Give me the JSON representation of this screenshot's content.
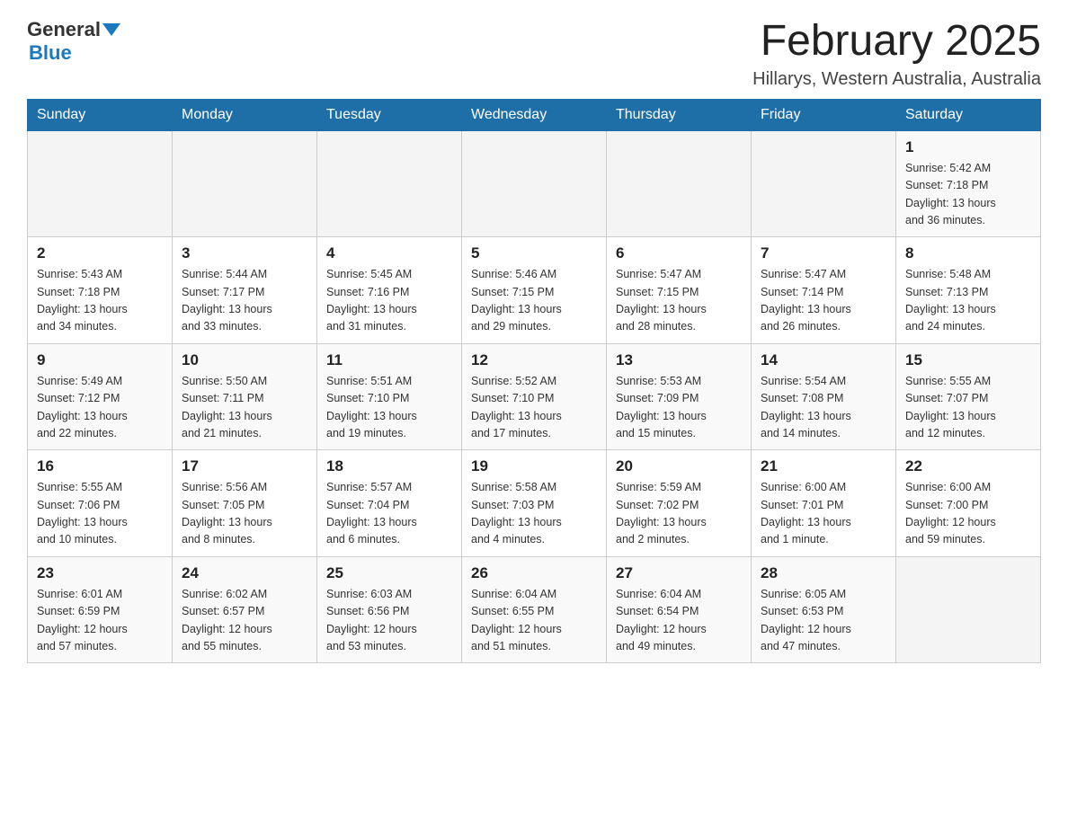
{
  "header": {
    "logo_general": "General",
    "logo_blue": "Blue",
    "title": "February 2025",
    "location": "Hillarys, Western Australia, Australia"
  },
  "days_of_week": [
    "Sunday",
    "Monday",
    "Tuesday",
    "Wednesday",
    "Thursday",
    "Friday",
    "Saturday"
  ],
  "weeks": [
    [
      {
        "day": "",
        "info": ""
      },
      {
        "day": "",
        "info": ""
      },
      {
        "day": "",
        "info": ""
      },
      {
        "day": "",
        "info": ""
      },
      {
        "day": "",
        "info": ""
      },
      {
        "day": "",
        "info": ""
      },
      {
        "day": "1",
        "info": "Sunrise: 5:42 AM\nSunset: 7:18 PM\nDaylight: 13 hours\nand 36 minutes."
      }
    ],
    [
      {
        "day": "2",
        "info": "Sunrise: 5:43 AM\nSunset: 7:18 PM\nDaylight: 13 hours\nand 34 minutes."
      },
      {
        "day": "3",
        "info": "Sunrise: 5:44 AM\nSunset: 7:17 PM\nDaylight: 13 hours\nand 33 minutes."
      },
      {
        "day": "4",
        "info": "Sunrise: 5:45 AM\nSunset: 7:16 PM\nDaylight: 13 hours\nand 31 minutes."
      },
      {
        "day": "5",
        "info": "Sunrise: 5:46 AM\nSunset: 7:15 PM\nDaylight: 13 hours\nand 29 minutes."
      },
      {
        "day": "6",
        "info": "Sunrise: 5:47 AM\nSunset: 7:15 PM\nDaylight: 13 hours\nand 28 minutes."
      },
      {
        "day": "7",
        "info": "Sunrise: 5:47 AM\nSunset: 7:14 PM\nDaylight: 13 hours\nand 26 minutes."
      },
      {
        "day": "8",
        "info": "Sunrise: 5:48 AM\nSunset: 7:13 PM\nDaylight: 13 hours\nand 24 minutes."
      }
    ],
    [
      {
        "day": "9",
        "info": "Sunrise: 5:49 AM\nSunset: 7:12 PM\nDaylight: 13 hours\nand 22 minutes."
      },
      {
        "day": "10",
        "info": "Sunrise: 5:50 AM\nSunset: 7:11 PM\nDaylight: 13 hours\nand 21 minutes."
      },
      {
        "day": "11",
        "info": "Sunrise: 5:51 AM\nSunset: 7:10 PM\nDaylight: 13 hours\nand 19 minutes."
      },
      {
        "day": "12",
        "info": "Sunrise: 5:52 AM\nSunset: 7:10 PM\nDaylight: 13 hours\nand 17 minutes."
      },
      {
        "day": "13",
        "info": "Sunrise: 5:53 AM\nSunset: 7:09 PM\nDaylight: 13 hours\nand 15 minutes."
      },
      {
        "day": "14",
        "info": "Sunrise: 5:54 AM\nSunset: 7:08 PM\nDaylight: 13 hours\nand 14 minutes."
      },
      {
        "day": "15",
        "info": "Sunrise: 5:55 AM\nSunset: 7:07 PM\nDaylight: 13 hours\nand 12 minutes."
      }
    ],
    [
      {
        "day": "16",
        "info": "Sunrise: 5:55 AM\nSunset: 7:06 PM\nDaylight: 13 hours\nand 10 minutes."
      },
      {
        "day": "17",
        "info": "Sunrise: 5:56 AM\nSunset: 7:05 PM\nDaylight: 13 hours\nand 8 minutes."
      },
      {
        "day": "18",
        "info": "Sunrise: 5:57 AM\nSunset: 7:04 PM\nDaylight: 13 hours\nand 6 minutes."
      },
      {
        "day": "19",
        "info": "Sunrise: 5:58 AM\nSunset: 7:03 PM\nDaylight: 13 hours\nand 4 minutes."
      },
      {
        "day": "20",
        "info": "Sunrise: 5:59 AM\nSunset: 7:02 PM\nDaylight: 13 hours\nand 2 minutes."
      },
      {
        "day": "21",
        "info": "Sunrise: 6:00 AM\nSunset: 7:01 PM\nDaylight: 13 hours\nand 1 minute."
      },
      {
        "day": "22",
        "info": "Sunrise: 6:00 AM\nSunset: 7:00 PM\nDaylight: 12 hours\nand 59 minutes."
      }
    ],
    [
      {
        "day": "23",
        "info": "Sunrise: 6:01 AM\nSunset: 6:59 PM\nDaylight: 12 hours\nand 57 minutes."
      },
      {
        "day": "24",
        "info": "Sunrise: 6:02 AM\nSunset: 6:57 PM\nDaylight: 12 hours\nand 55 minutes."
      },
      {
        "day": "25",
        "info": "Sunrise: 6:03 AM\nSunset: 6:56 PM\nDaylight: 12 hours\nand 53 minutes."
      },
      {
        "day": "26",
        "info": "Sunrise: 6:04 AM\nSunset: 6:55 PM\nDaylight: 12 hours\nand 51 minutes."
      },
      {
        "day": "27",
        "info": "Sunrise: 6:04 AM\nSunset: 6:54 PM\nDaylight: 12 hours\nand 49 minutes."
      },
      {
        "day": "28",
        "info": "Sunrise: 6:05 AM\nSunset: 6:53 PM\nDaylight: 12 hours\nand 47 minutes."
      },
      {
        "day": "",
        "info": ""
      }
    ]
  ]
}
